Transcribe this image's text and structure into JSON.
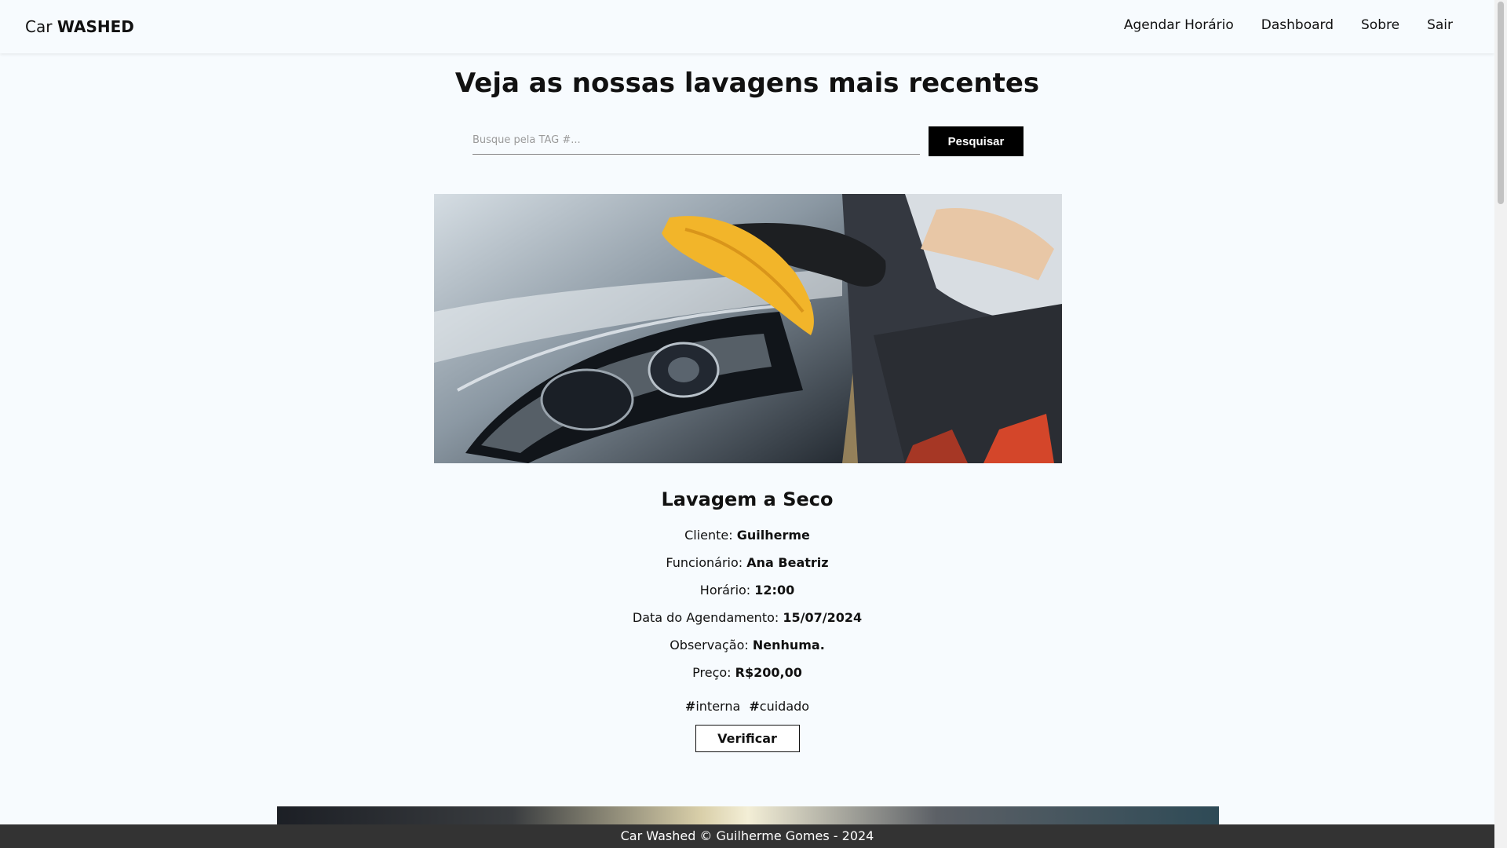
{
  "navbar": {
    "brand_prefix": "Car",
    "brand_bold": "WASHED",
    "links": [
      "Agendar Horário",
      "Dashboard",
      "Sobre",
      "Sair"
    ]
  },
  "main": {
    "title": "Veja as nossas lavagens mais recentes",
    "search": {
      "placeholder": "Busque pela TAG #...",
      "value": "",
      "button": "Pesquisar"
    }
  },
  "card": {
    "title": "Lavagem a Seco",
    "details": [
      {
        "label": "Cliente:",
        "value": "Guilherme"
      },
      {
        "label": "Funcionário:",
        "value": "Ana Beatriz"
      },
      {
        "label": "Horário:",
        "value": "12:00"
      },
      {
        "label": "Data do Agendamento:",
        "value": "15/07/2024"
      },
      {
        "label": "Observação:",
        "value": "Nenhuma."
      },
      {
        "label": "Preço:",
        "value": "R$200,00"
      }
    ],
    "tags": [
      {
        "hash": "#",
        "name": "interna"
      },
      {
        "hash": "#",
        "name": "cuidado"
      }
    ],
    "verify_button": "Verificar"
  },
  "footer": {
    "text": "Car Washed © Guilherme Gomes - 2024"
  },
  "colors": {
    "background": "#f7fbfe",
    "button": "#000000",
    "footer": "#333333",
    "cloth": "#f2b52a"
  }
}
